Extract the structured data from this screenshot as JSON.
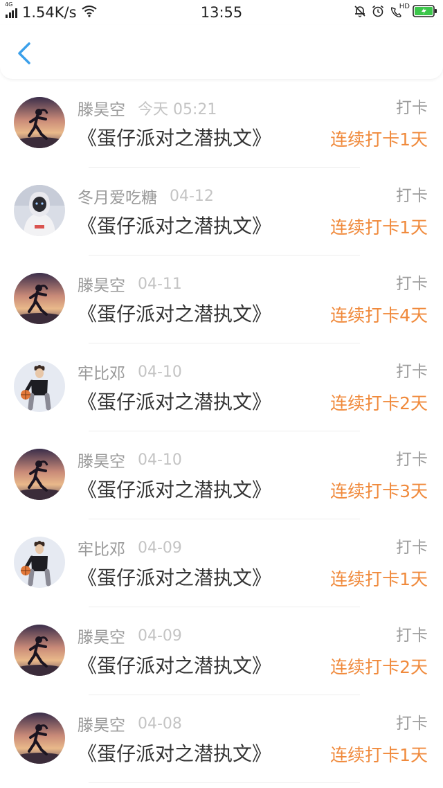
{
  "status_bar": {
    "network": "4G",
    "speed": "1.54K/s",
    "time": "13:55",
    "hd_label": "HD"
  },
  "nav": {
    "back_icon": "chevron-left-icon"
  },
  "colors": {
    "accent": "#3ba0ea",
    "streak": "#f08a3c",
    "name": "#9a9a9a",
    "date": "#c4c4c4"
  },
  "entries": [
    {
      "name": "滕昊空",
      "date": "今天 05:21",
      "title": "《蛋仔派对之潜执文》",
      "tag": "打卡",
      "streak": "连续打卡1天",
      "avatar": "girl-running-sunset"
    },
    {
      "name": "冬月爱吃糖",
      "date": "04-12",
      "title": "《蛋仔派对之潜执文》",
      "tag": "打卡",
      "streak": "连续打卡1天",
      "avatar": "hooded-figure"
    },
    {
      "name": "滕昊空",
      "date": "04-11",
      "title": "《蛋仔派对之潜执文》",
      "tag": "打卡",
      "streak": "连续打卡4天",
      "avatar": "girl-running-sunset"
    },
    {
      "name": "牢比邓",
      "date": "04-10",
      "title": "《蛋仔派对之潜执文》",
      "tag": "打卡",
      "streak": "连续打卡2天",
      "avatar": "basketball-player"
    },
    {
      "name": "滕昊空",
      "date": "04-10",
      "title": "《蛋仔派对之潜执文》",
      "tag": "打卡",
      "streak": "连续打卡3天",
      "avatar": "girl-running-sunset"
    },
    {
      "name": "牢比邓",
      "date": "04-09",
      "title": "《蛋仔派对之潜执文》",
      "tag": "打卡",
      "streak": "连续打卡1天",
      "avatar": "basketball-player"
    },
    {
      "name": "滕昊空",
      "date": "04-09",
      "title": "《蛋仔派对之潜执文》",
      "tag": "打卡",
      "streak": "连续打卡2天",
      "avatar": "girl-running-sunset"
    },
    {
      "name": "滕昊空",
      "date": "04-08",
      "title": "《蛋仔派对之潜执文》",
      "tag": "打卡",
      "streak": "连续打卡1天",
      "avatar": "girl-running-sunset"
    }
  ]
}
